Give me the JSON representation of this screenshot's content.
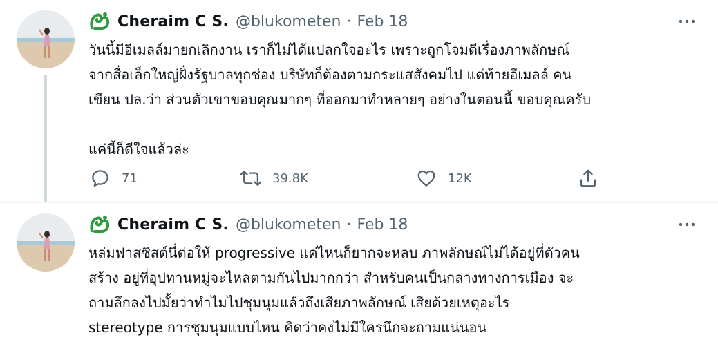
{
  "tweets": [
    {
      "author": {
        "display_name": "Cheraim C S.",
        "handle": "@blukometen",
        "logo_icon": "green-thai-letter-logo"
      },
      "separator": "·",
      "date": "Feb 18",
      "more_icon": "more-dots-icon",
      "text_lines": [
        "วันนี้มีอีเมลล์มายกเลิกงาน เราก็ไม่ได้แปลกใจอะไร เพราะถูกโจมตีเรื่องภาพลักษณ์",
        "จากสื่อเล็กใหญ่ฝั่งรัฐบาลทุกช่อง บริษัทก็ต้องตามกระแสสังคมไป แต่ท้ายอีเมลล์ คน",
        "เขียน ปล.ว่า ส่วนตัวเขาขอบคุณมากๆ ที่ออกมาทำหลายๆ อย่างในตอนนี้ ขอบคุณครับ",
        "",
        "แค่นี้ก็ดีใจแล้วล่ะ"
      ],
      "actions": {
        "reply_count": "71",
        "retweet_count": "39.8K",
        "like_count": "12K"
      }
    },
    {
      "author": {
        "display_name": "Cheraim C S.",
        "handle": "@blukometen",
        "logo_icon": "green-thai-letter-logo"
      },
      "separator": "·",
      "date": "Feb 18",
      "more_icon": "more-dots-icon",
      "text_lines": [
        "หล่มฟาสซิสต์นี่ต่อให้ progressive แค่ไหนก็ยากจะหลบ ภาพลักษณ์ไม่ได้อยู่ที่ตัวคน",
        "สร้าง อยู่ที่อุปทานหมู่จะไหลตามกันไปมากกว่า สำหรับคนเป็นกลางทางการเมือง จะ",
        "ถามลึกลงไปมั้ยว่าทำไมไปชุมนุมแล้วถึงเสียภาพลักษณ์ เสียด้วยเหตุอะไร",
        "stereotype การชุมนุมแบบไหน คิดว่าคงไม่มีใครนึกจะถามแน่นอน"
      ]
    }
  ],
  "colors": {
    "text_primary": "#0f1419",
    "text_secondary": "#536471",
    "thread_line": "#cfd9de",
    "logo_green": "#2e9b3e"
  }
}
